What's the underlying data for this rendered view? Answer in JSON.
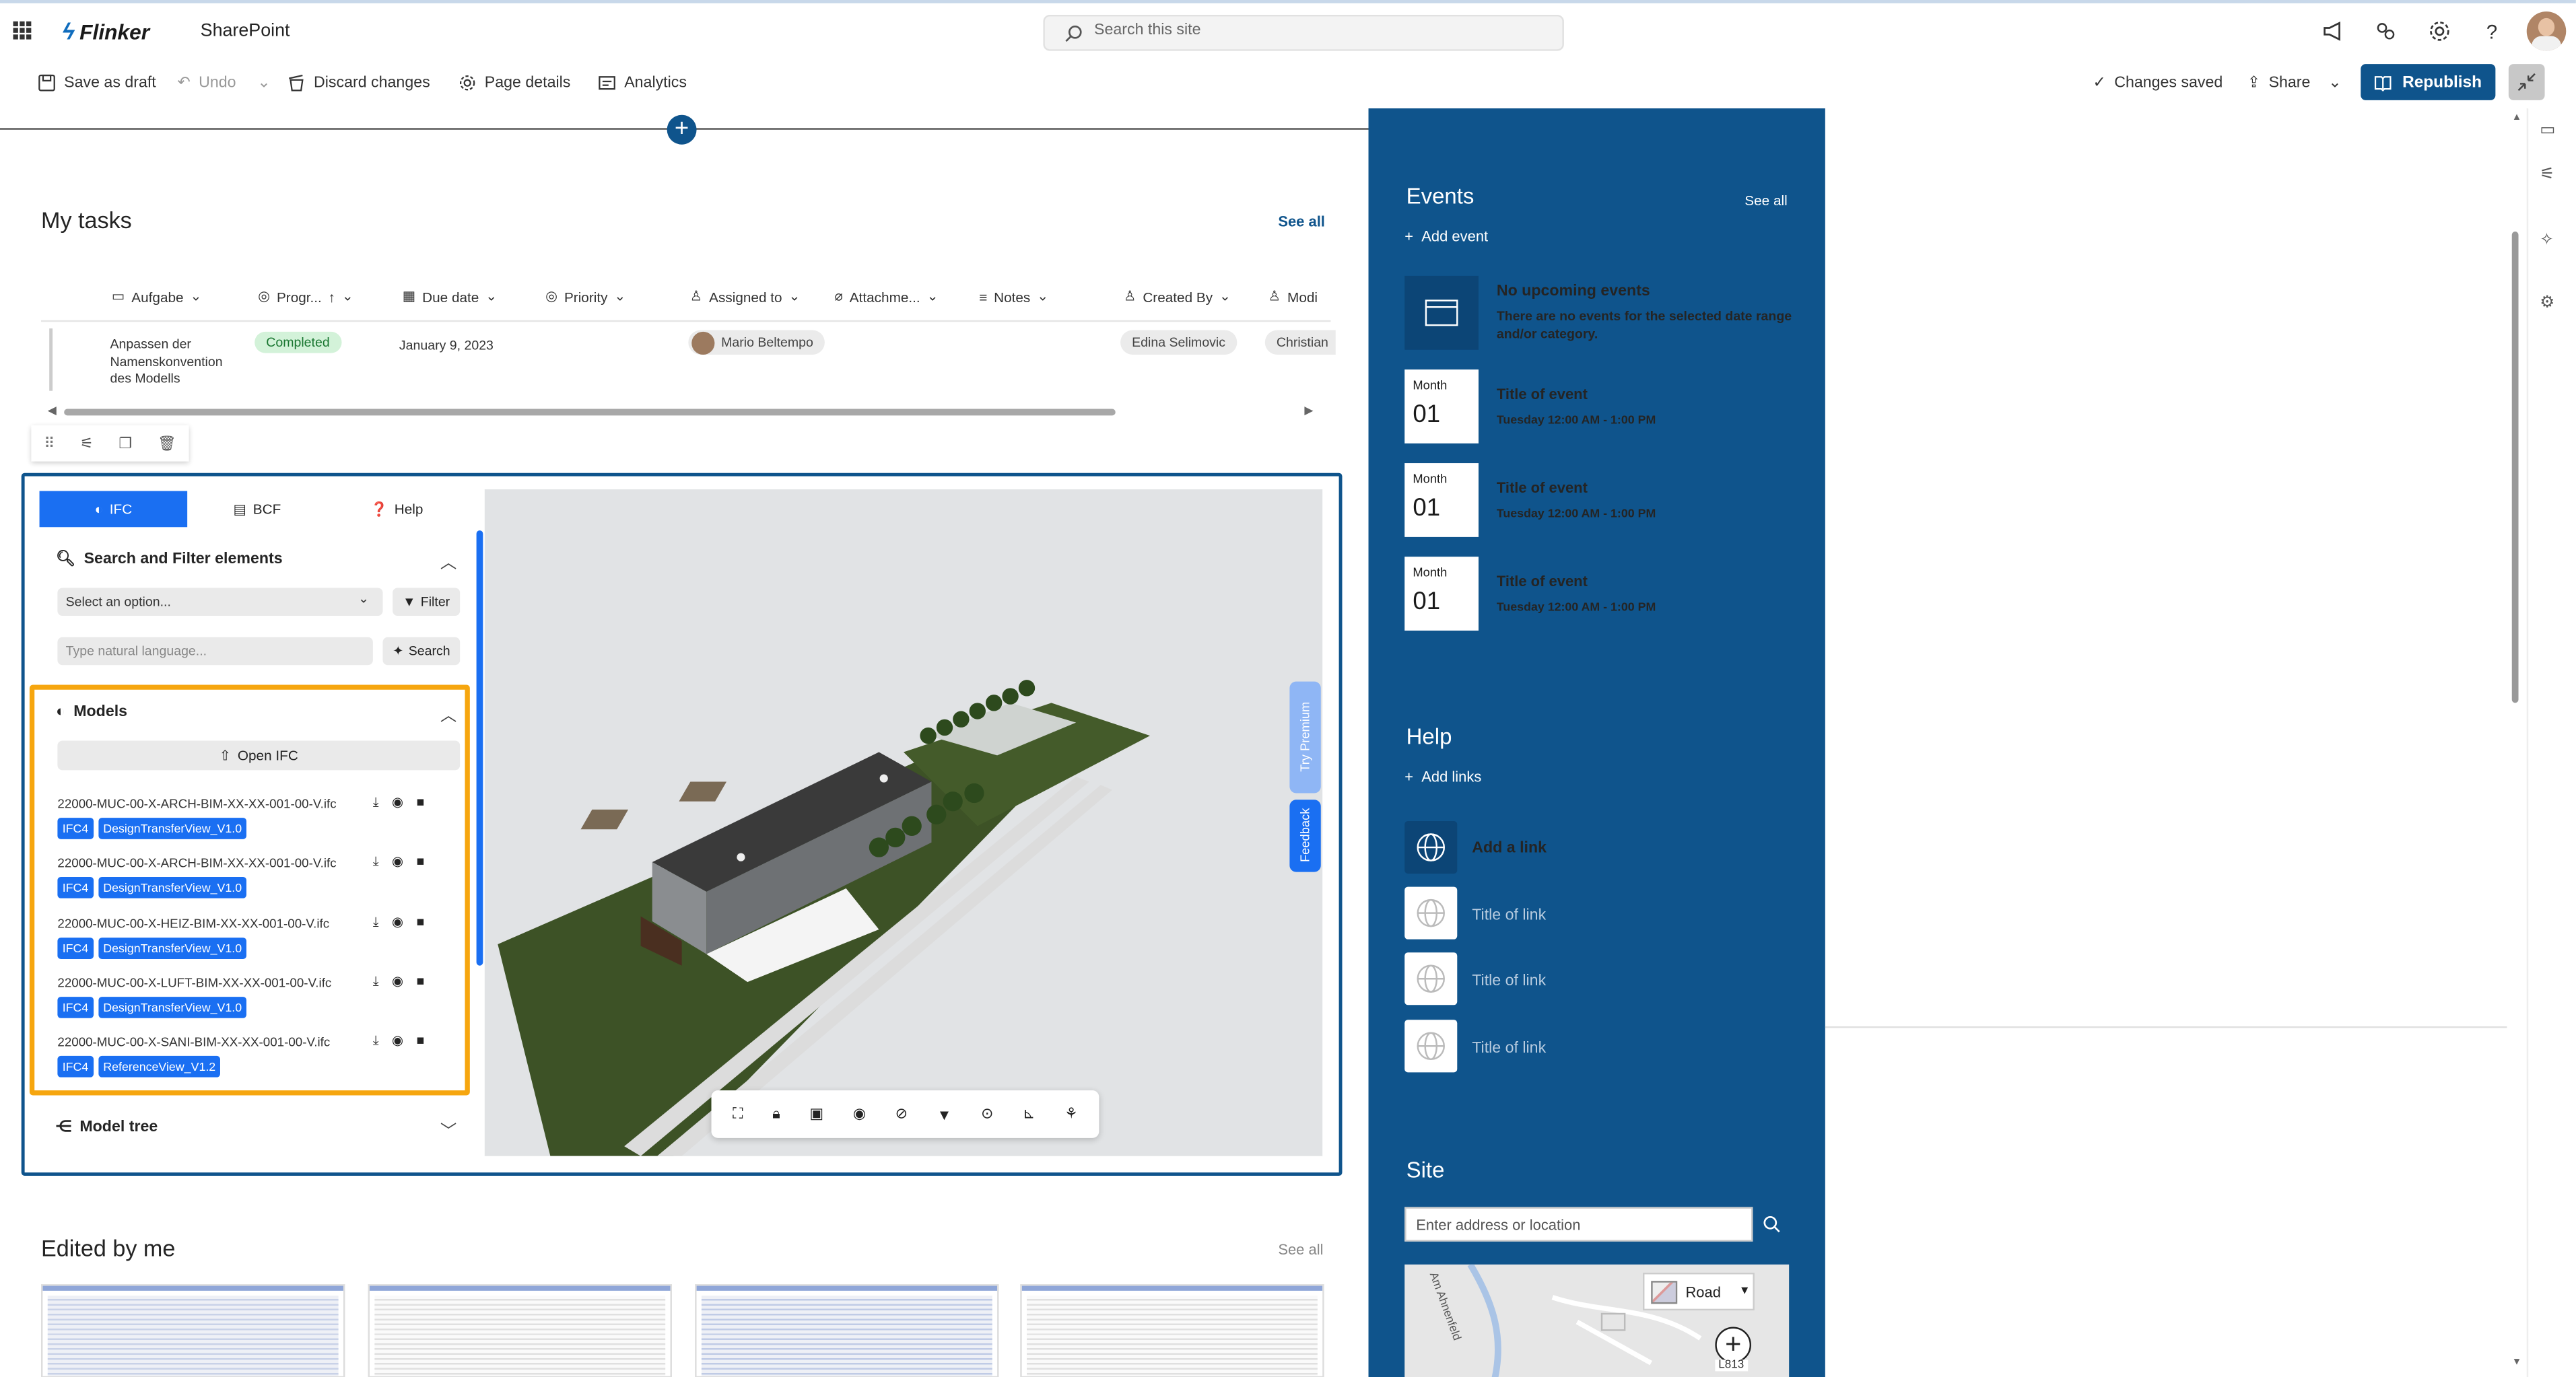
{
  "suite": {
    "brand": "Flinker",
    "app": "SharePoint",
    "search_placeholder": "Search this site"
  },
  "commands": {
    "save_draft": "Save as draft",
    "undo": "Undo",
    "discard": "Discard changes",
    "page_details": "Page details",
    "analytics": "Analytics",
    "changes_saved": "Changes saved",
    "share": "Share",
    "republish": "Republish"
  },
  "tasks": {
    "title": "My tasks",
    "see_all": "See all",
    "columns": [
      "Aufgabe",
      "Progr...",
      "Due date",
      "Priority",
      "Assigned to",
      "Attachme...",
      "Notes",
      "Created By",
      "Modi"
    ],
    "row": {
      "task": "Anpassen der Namenskonvention des Modells",
      "progress": "Completed",
      "due": "January 9, 2023",
      "assigned": "Mario Beltempo",
      "created_by": "Edina Selimovic",
      "modified": "Christian"
    }
  },
  "ifc": {
    "tabs": [
      "IFC",
      "BCF",
      "Help"
    ],
    "search_section": "Search and Filter elements",
    "select_placeholder": "Select an option...",
    "filter_button": "Filter",
    "nl_placeholder": "Type natural language...",
    "search_button": "Search",
    "models_section": "Models",
    "open_ifc": "Open IFC",
    "models": [
      {
        "file": "22000-MUC-00-X-ARCH-BIM-XX-XX-001-00-V.ifc",
        "schema": "IFC4",
        "view": "DesignTransferView_V1.0"
      },
      {
        "file": "22000-MUC-00-X-ARCH-BIM-XX-XX-001-00-V.ifc",
        "schema": "IFC4",
        "view": "DesignTransferView_V1.0"
      },
      {
        "file": "22000-MUC-00-X-HEIZ-BIM-XX-XX-001-00-V.ifc",
        "schema": "IFC4",
        "view": "DesignTransferView_V1.0"
      },
      {
        "file": "22000-MUC-00-X-LUFT-BIM-XX-XX-001-00-V.ifc",
        "schema": "IFC4",
        "view": "DesignTransferView_V1.0"
      },
      {
        "file": "22000-MUC-00-X-SANI-BIM-XX-XX-001-00-V.ifc",
        "schema": "IFC4",
        "view": "ReferenceView_V1.2"
      }
    ],
    "model_tree": "Model tree",
    "try_premium": "Try Premium",
    "feedback": "Feedback"
  },
  "edited": {
    "title": "Edited by me",
    "see_all": "See all"
  },
  "events": {
    "title": "Events",
    "see_all": "See all",
    "add": "Add event",
    "none_title": "No upcoming events",
    "none_desc": "There are no events for the selected date range and/or category.",
    "items": [
      {
        "month": "Month",
        "day": "01",
        "title": "Title of event",
        "time": "Tuesday 12:00 AM - 1:00 PM"
      },
      {
        "month": "Month",
        "day": "01",
        "title": "Title of event",
        "time": "Tuesday 12:00 AM - 1:00 PM"
      },
      {
        "month": "Month",
        "day": "01",
        "title": "Title of event",
        "time": "Tuesday 12:00 AM - 1:00 PM"
      }
    ]
  },
  "help": {
    "title": "Help",
    "add_links": "Add links",
    "add_link": "Add a link",
    "links": [
      "Title of link",
      "Title of link",
      "Title of link"
    ]
  },
  "site": {
    "title": "Site",
    "placeholder": "Enter address or location",
    "map_mode": "Road",
    "map_label": "Am Ahnenfeld",
    "road_badge": "L813"
  },
  "colors": {
    "brand_blue": "#0f548c",
    "tab_blue": "#1a6ff2",
    "highlight": "#f6a60f",
    "completed_bg": "#d3f2d9"
  }
}
